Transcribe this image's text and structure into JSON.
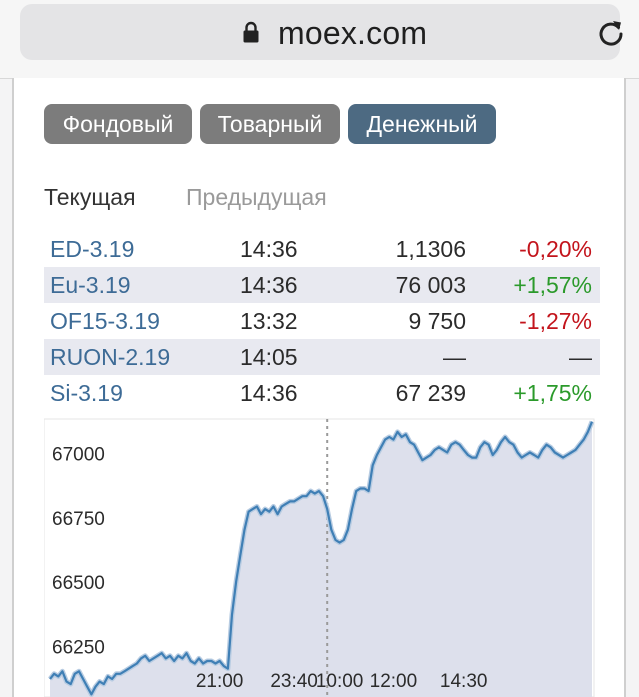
{
  "browser": {
    "url": "moex.com",
    "lock_icon": "lock-icon",
    "reload_icon": "reload-icon"
  },
  "tabs": [
    {
      "label": "Фондовый",
      "active": false
    },
    {
      "label": "Товарный",
      "active": false
    },
    {
      "label": "Денежный",
      "active": true
    }
  ],
  "subtabs": {
    "current": "Текущая",
    "previous": "Предыдущая"
  },
  "quotes": [
    {
      "ticker": "ED-3.19",
      "time": "14:36",
      "price": "1,1306",
      "change": "-0,20%",
      "trend": "neg"
    },
    {
      "ticker": "Eu-3.19",
      "time": "14:36",
      "price": "76 003",
      "change": "+1,57%",
      "trend": "pos"
    },
    {
      "ticker": "OF15-3.19",
      "time": "13:32",
      "price": "9 750",
      "change": "-1,27%",
      "trend": "neg"
    },
    {
      "ticker": "RUON-2.19",
      "time": "14:05",
      "price": "—",
      "change": "—",
      "trend": "nil"
    },
    {
      "ticker": "Si-3.19",
      "time": "14:36",
      "price": "67 239",
      "change": "+1,75%",
      "trend": "pos"
    }
  ],
  "colors": {
    "active_tab": "#4d6a82",
    "inactive_tab": "#7c7c7c",
    "negative": "#c3141c",
    "positive": "#2b9a2b",
    "ticker": "#3d6b96",
    "line": "#3f7fb5",
    "area": "#dde0ec"
  },
  "chart_data": {
    "type": "area",
    "ylim": [
      66050,
      67130
    ],
    "y_ticks": [
      "67000",
      "66750",
      "66500",
      "66250"
    ],
    "y_tick_values": [
      67000,
      66750,
      66500,
      66250
    ],
    "x_tick_labels": [
      "21:00",
      "23:40",
      "10:00",
      "12:00",
      "14:30"
    ],
    "x_tick_index": [
      41,
      59,
      70,
      83,
      100
    ],
    "session_break_index": 67,
    "values": [
      66120,
      66140,
      66130,
      66150,
      66110,
      66100,
      66140,
      66150,
      66120,
      66090,
      66060,
      66090,
      66110,
      66100,
      66130,
      66120,
      66140,
      66140,
      66150,
      66160,
      66170,
      66180,
      66200,
      66210,
      66190,
      66200,
      66210,
      66220,
      66200,
      66210,
      66190,
      66210,
      66200,
      66220,
      66190,
      66180,
      66200,
      66180,
      66190,
      66190,
      66180,
      66190,
      66170,
      66160,
      66370,
      66500,
      66600,
      66700,
      66770,
      66780,
      66790,
      66760,
      66780,
      66770,
      66790,
      66760,
      66790,
      66800,
      66810,
      66810,
      66820,
      66830,
      66830,
      66850,
      66840,
      66850,
      66830,
      66780,
      66700,
      66660,
      66650,
      66660,
      66700,
      66780,
      66850,
      66860,
      66860,
      66850,
      66950,
      66990,
      67020,
      67050,
      67060,
      67050,
      67080,
      67060,
      67070,
      67040,
      67030,
      67000,
      66970,
      66980,
      66990,
      67010,
      67020,
      67010,
      67000,
      67030,
      67040,
      67030,
      67010,
      66990,
      66980,
      66980,
      67020,
      67040,
      67030,
      66990,
      67010,
      67040,
      67060,
      67040,
      67030,
      67000,
      66980,
      66990,
      67000,
      66990,
      66980,
      67010,
      67030,
      67020,
      67000,
      66990,
      66980,
      66990,
      67000,
      67010,
      67030,
      67050,
      67080,
      67120
    ]
  }
}
